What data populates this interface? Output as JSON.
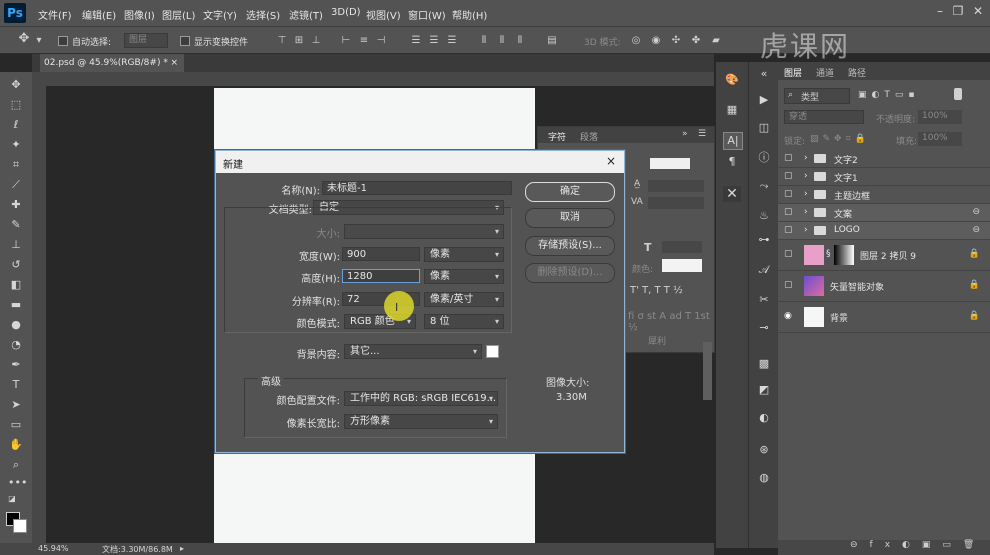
{
  "app": {
    "logo": "Ps"
  },
  "menu": [
    "文件(F)",
    "编辑(E)",
    "图像(I)",
    "图层(L)",
    "文字(Y)",
    "选择(S)",
    "滤镜(T)",
    "3D(D)",
    "视图(V)",
    "窗口(W)",
    "帮助(H)"
  ],
  "options_bar": {
    "auto_select": "自动选择:",
    "auto_select_value": "图层",
    "show_transform": "显示变换控件",
    "mode_3d": "3D 模式:"
  },
  "watermark": "虎课网",
  "document_tab": {
    "title": "02.psd @ 45.9%(RGB/8#) *",
    "close": "×"
  },
  "statusbar": {
    "zoom": "45.94%",
    "doc": "文档:3.30M/86.8M"
  },
  "character_panel": {
    "tabs": [
      "字符",
      "段落"
    ],
    "colour_label": "颜色:",
    "anti_alias": "犀利"
  },
  "layers_panel": {
    "tabs": [
      "图层",
      "通道",
      "路径"
    ],
    "kind": "类型",
    "blend": "穿透",
    "opacity_label": "不透明度:",
    "opacity": "100%",
    "lock_label": "锁定:",
    "fill_label": "填充:",
    "fill": "100%",
    "layers": [
      {
        "name": "文字2",
        "kind": "group"
      },
      {
        "name": "文字1",
        "kind": "group"
      },
      {
        "name": "主题边框",
        "kind": "group"
      },
      {
        "name": "文案",
        "kind": "group"
      },
      {
        "name": "LOGO",
        "kind": "group"
      },
      {
        "name": "图层 2 拷贝 9",
        "kind": "masked"
      },
      {
        "name": "矢量智能对象",
        "kind": "smart"
      },
      {
        "name": "背景",
        "kind": "background"
      }
    ]
  },
  "dialog": {
    "title": "新建",
    "close": "×",
    "name_label": "名称(N):",
    "name_value": "未标题-1",
    "preset_label": "文档类型:",
    "preset_value": "自定",
    "size_label": "大小:",
    "width_label": "宽度(W):",
    "width_value": "900",
    "width_unit": "像素",
    "height_label": "高度(H):",
    "height_value": "1280",
    "height_unit": "像素",
    "resolution_label": "分辨率(R):",
    "resolution_value": "72",
    "resolution_unit": "像素/英寸",
    "mode_label": "颜色模式:",
    "mode_value": "RGB 颜色",
    "depth_value": "8 位",
    "background_label": "背景内容:",
    "background_value": "其它...",
    "advanced_label": "高级",
    "profile_label": "颜色配置文件:",
    "profile_value": "工作中的 RGB: sRGB IEC619...",
    "aspect_label": "像素长宽比:",
    "aspect_value": "方形像素",
    "ok_button": "确定",
    "cancel_button": "取消",
    "save_preset_button": "存储预设(S)...",
    "delete_preset_button": "删除预设(D)...",
    "image_size_label": "图像大小:",
    "image_size_value": "3.30M"
  }
}
